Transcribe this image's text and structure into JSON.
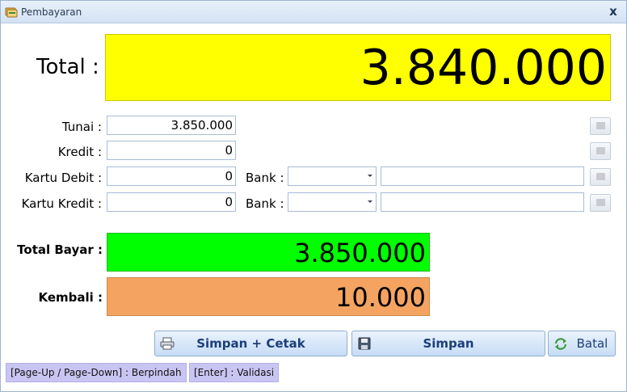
{
  "window": {
    "title": "Pembayaran",
    "close_label": "x"
  },
  "total": {
    "label": "Total :",
    "value": "3.840.000"
  },
  "rows": {
    "tunai": {
      "label": "Tunai :",
      "value": "3.850.000"
    },
    "kredit": {
      "label": "Kredit :",
      "value": "0"
    },
    "kartu_debit": {
      "label": "Kartu Debit :",
      "value": "0",
      "bank_label": "Bank :",
      "bank_value": "",
      "ref_value": ""
    },
    "kartu_kredit": {
      "label": "Kartu Kredit :",
      "value": "0",
      "bank_label": "Bank :",
      "bank_value": "",
      "ref_value": ""
    }
  },
  "total_bayar": {
    "label": "Total Bayar :",
    "value": "3.850.000",
    "color": "#00ff00"
  },
  "kembali": {
    "label": "Kembali :",
    "value": "10.000",
    "color": "#f4a460"
  },
  "buttons": {
    "simpan_cetak": "Simpan + Cetak",
    "simpan": "Simpan",
    "batal": "Batal"
  },
  "hints": {
    "navigate": "[Page-Up / Page-Down] : Berpindah",
    "validate": "[Enter] : Validasi"
  },
  "colors": {
    "total_bg": "#ffff00",
    "button_text": "#1c3e7a"
  }
}
